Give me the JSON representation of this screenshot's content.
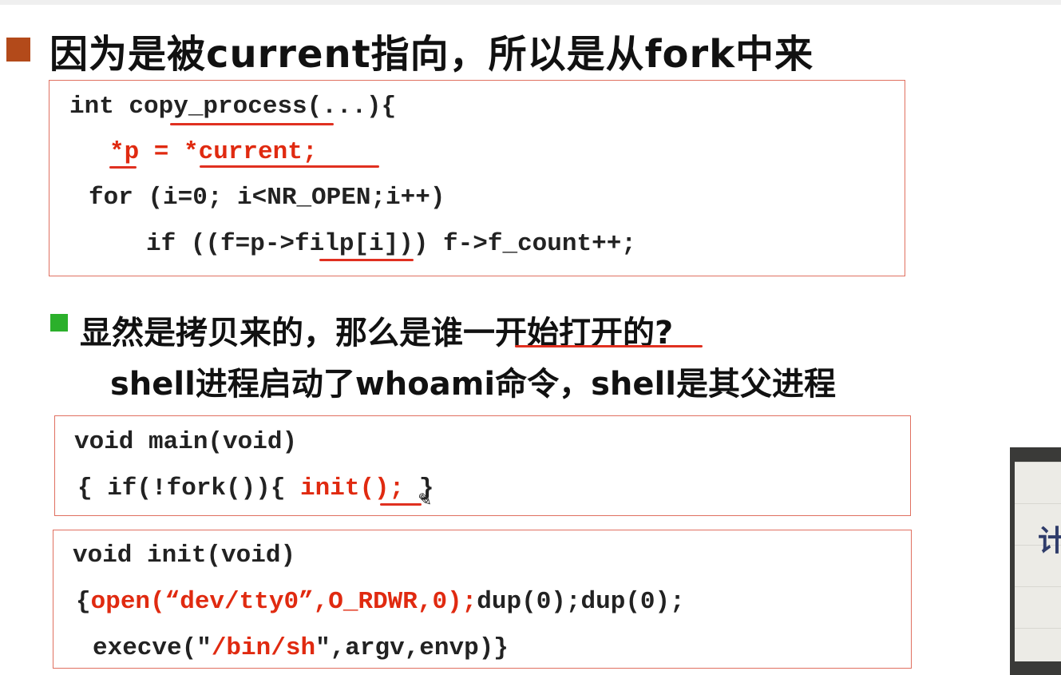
{
  "heading": "因为是被current指向，所以是从fork中来",
  "code_block_1": {
    "line1": "int copy_process(...){",
    "line2": "*p = *current;",
    "line3": "for (i=0; i<NR_OPEN;i++)",
    "line4": "if ((f=p->filp[i])) f->f_count++;"
  },
  "sub_point": {
    "line1": "显然是拷贝来的，那么是谁一开始打开的?",
    "line2": "shell进程启动了whoami命令，shell是其父进程"
  },
  "code_block_2": {
    "line1": "void main(void)",
    "line2_prefix": "{ if(!fork()){ ",
    "line2_red": "init();",
    "line2_suffix": " }"
  },
  "code_block_3": {
    "line1": "void init(void)",
    "line2_brace": "{",
    "line2_red": "open(“dev/tty0”,O_RDWR,0);",
    "line2_rest": "dup(0);dup(0);",
    "line3_prefix": "execve(\"",
    "line3_red": "/bin/sh",
    "line3_suffix": "\",argv,envp)}"
  },
  "photo_glyph": "计",
  "colors": {
    "accent_red": "#e02a10",
    "bullet_main": "#b34a1a",
    "bullet_sub": "#2bb02b",
    "box_border": "#e07060"
  }
}
